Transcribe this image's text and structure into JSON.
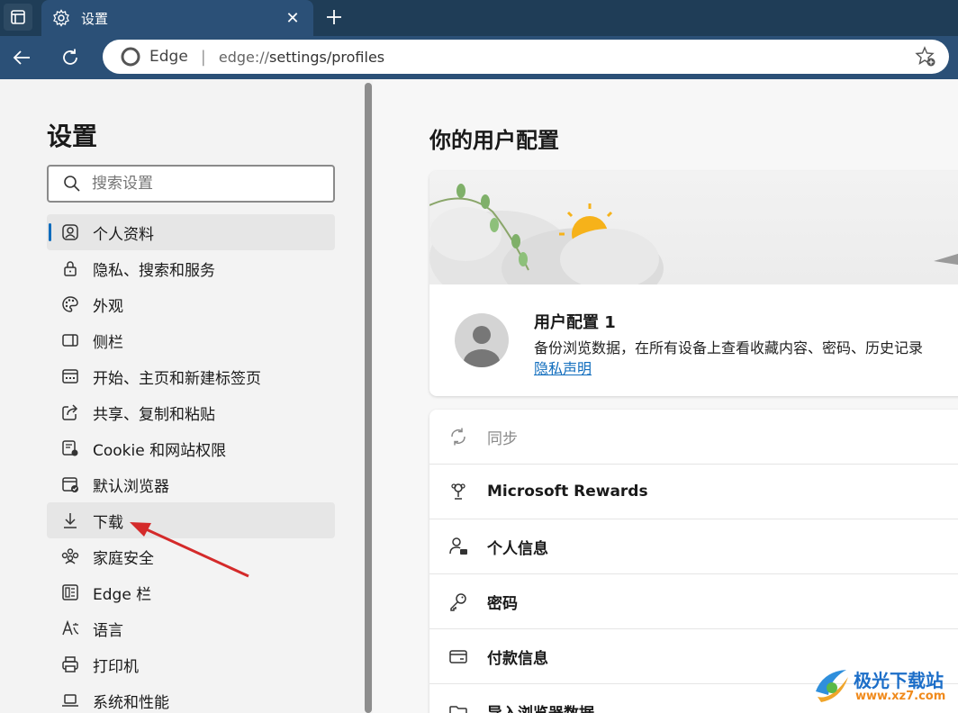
{
  "tab": {
    "title": "设置"
  },
  "address": {
    "brand": "Edge",
    "separator": "|",
    "scheme": "edge://",
    "path": "settings/profiles"
  },
  "sidebar": {
    "title": "设置",
    "search_placeholder": "搜索设置",
    "items": [
      {
        "label": "个人资料",
        "icon": "profile-icon"
      },
      {
        "label": "隐私、搜索和服务",
        "icon": "lock-icon"
      },
      {
        "label": "外观",
        "icon": "palette-icon"
      },
      {
        "label": "侧栏",
        "icon": "sidebar-icon"
      },
      {
        "label": "开始、主页和新建标签页",
        "icon": "home-tabs-icon"
      },
      {
        "label": "共享、复制和粘贴",
        "icon": "share-icon"
      },
      {
        "label": "Cookie 和网站权限",
        "icon": "cookie-icon"
      },
      {
        "label": "默认浏览器",
        "icon": "browser-icon"
      },
      {
        "label": "下载",
        "icon": "download-icon"
      },
      {
        "label": "家庭安全",
        "icon": "family-icon"
      },
      {
        "label": "Edge 栏",
        "icon": "edge-bar-icon"
      },
      {
        "label": "语言",
        "icon": "language-icon"
      },
      {
        "label": "打印机",
        "icon": "printer-icon"
      },
      {
        "label": "系统和性能",
        "icon": "laptop-icon"
      }
    ]
  },
  "main": {
    "title": "你的用户配置",
    "profile": {
      "name": "用户配置 1",
      "description": "备份浏览数据，在所有设备上查看收藏内容、密码、历史记录",
      "privacy_link": "隐私声明"
    },
    "rows": [
      {
        "label": "同步",
        "icon": "sync-icon"
      },
      {
        "label": "Microsoft Rewards",
        "icon": "trophy-icon"
      },
      {
        "label": "个人信息",
        "icon": "person-card-icon"
      },
      {
        "label": "密码",
        "icon": "key-icon"
      },
      {
        "label": "付款信息",
        "icon": "credit-card-icon"
      },
      {
        "label": "导入浏览器数据",
        "icon": "folder-icon"
      }
    ]
  },
  "watermark": {
    "text": "极光下载站",
    "url": "www.xz7.com"
  },
  "colors": {
    "tab_strip": "#1f3d57",
    "toolbar": "#2b5077",
    "accent": "#0f6cbd",
    "arrow": "#d42a2a"
  }
}
